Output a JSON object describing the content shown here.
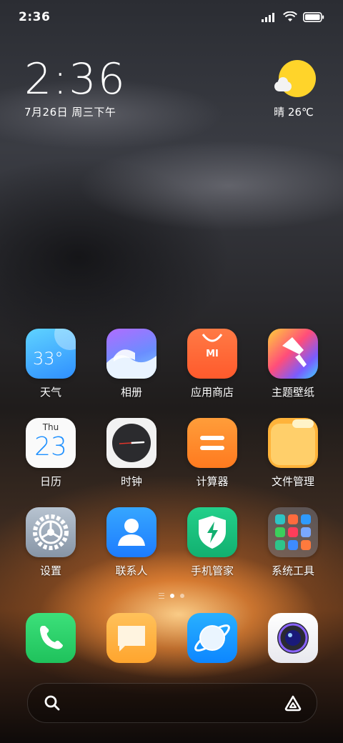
{
  "status_bar": {
    "time": "2:36",
    "icons": [
      "signal-icon",
      "wifi-icon",
      "battery-icon"
    ]
  },
  "clock_widget": {
    "time": "2:36",
    "date": "7月26日 周三下午"
  },
  "weather_widget": {
    "icon": "sunny-partly-cloudy-icon",
    "text": "晴 26℃"
  },
  "apps": [
    {
      "label": "天气",
      "icon": "weather-app-icon",
      "icon_text": "33°"
    },
    {
      "label": "相册",
      "icon": "gallery-app-icon"
    },
    {
      "label": "应用商店",
      "icon": "app-store-icon",
      "icon_text": "MI"
    },
    {
      "label": "主题壁纸",
      "icon": "themes-app-icon"
    },
    {
      "label": "日历",
      "icon": "calendar-app-icon",
      "icon_day": "Thu",
      "icon_date": "23"
    },
    {
      "label": "时钟",
      "icon": "clock-app-icon"
    },
    {
      "label": "计算器",
      "icon": "calculator-app-icon"
    },
    {
      "label": "文件管理",
      "icon": "file-manager-icon"
    },
    {
      "label": "设置",
      "icon": "settings-gear-icon"
    },
    {
      "label": "联系人",
      "icon": "contacts-app-icon"
    },
    {
      "label": "手机管家",
      "icon": "security-shield-icon"
    },
    {
      "label": "系统工具",
      "icon": "system-tools-folder-icon"
    }
  ],
  "page_indicator": {
    "pages": 2,
    "active": 1
  },
  "dock": [
    {
      "icon": "phone-app-icon"
    },
    {
      "icon": "messages-app-icon"
    },
    {
      "icon": "browser-app-icon"
    },
    {
      "icon": "camera-app-icon"
    }
  ],
  "search_bar": {
    "left_icon": "search-icon",
    "right_icon": "app-vault-icon"
  },
  "colors": {
    "sun": "#ffd42a",
    "phone_green": "#2fd36a",
    "messages_orange": "#ffb347",
    "browser_blue": "#1a9bff"
  }
}
